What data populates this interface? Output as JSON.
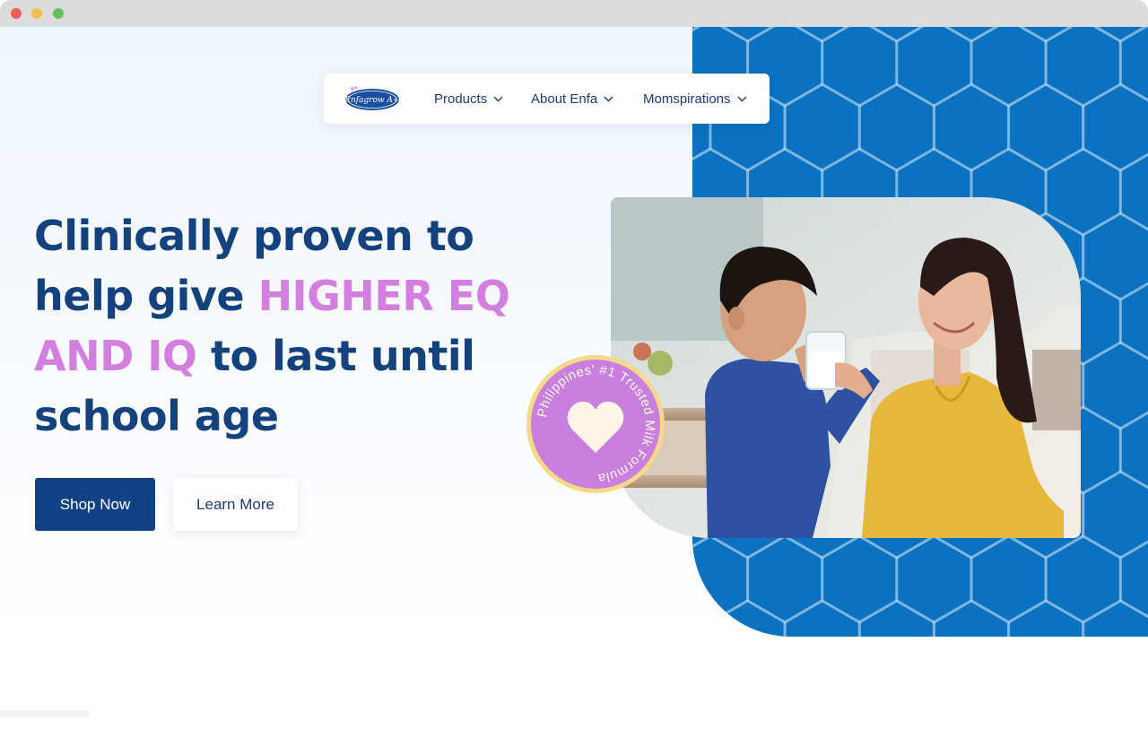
{
  "window": {
    "title": ""
  },
  "nav": {
    "logo_text": "Enfagrow A+",
    "items": [
      {
        "label": "Products"
      },
      {
        "label": "About Enfa"
      },
      {
        "label": "Momspirations"
      }
    ]
  },
  "hero": {
    "headline_part1": "Clinically proven to help give ",
    "headline_accent": "HIGHER EQ AND IQ",
    "headline_part2": " to last until school age",
    "primary_button": "Shop Now",
    "secondary_button": "Learn More"
  },
  "badge": {
    "text": "Philippines' #1 Trusted Milk Formula",
    "icon": "heart-icon"
  },
  "colors": {
    "brand_navy": "#13427e",
    "accent_pink": "#d37fe0",
    "panel_blue": "#0a72c0",
    "badge_purple": "#c97fde",
    "badge_ring": "#f6d889"
  }
}
